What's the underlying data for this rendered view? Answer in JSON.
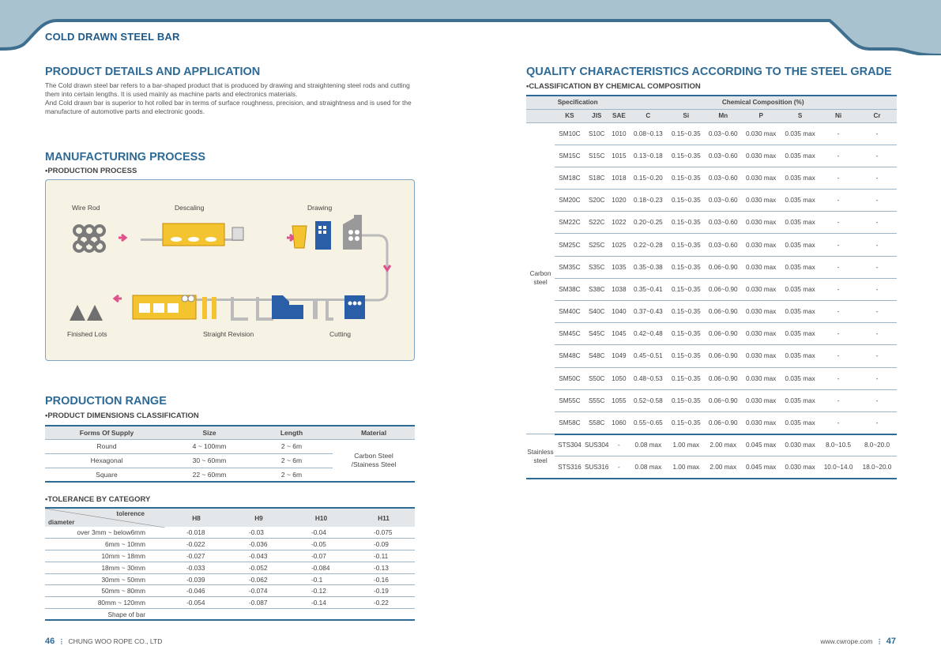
{
  "header": {
    "section_title": "COLD DRAWN STEEL BAR"
  },
  "left": {
    "details_title": "PRODUCT DETAILS AND APPLICATION",
    "details_text_1": "The Cold drawn steel bar refers to a bar-shaped product that is produced by drawing and straightening steel rods and cutting them into certain lengths. It is used mainly as machine parts and electronics materials.",
    "details_text_2": "And Cold drawn bar is superior to hot rolled bar in terms of surface roughness, precision, and straightness and is used for the manufacture of automotive parts and electronic goods.",
    "manufacturing_title": "MANUFACTURING PROCESS",
    "production_process_sub": "•PRODUCTION PROCESS",
    "process_labels": {
      "wire_rod": "Wire Rod",
      "descaling": "Descaling",
      "drawing": "Drawing",
      "finished_lots": "Finished Lots",
      "straight_revision": "Straight Revision",
      "cutting": "Cutting"
    },
    "range_title": "PRODUCTION RANGE",
    "dimensions_sub": "•PRODUCT DIMENSIONS CLASSIFICATION",
    "dimensions_table": {
      "headers": [
        "Forms Of Supply",
        "Size",
        "Length",
        "Material"
      ],
      "rows": [
        [
          "Round",
          "4 ~ 100mm",
          "2 ~ 6m"
        ],
        [
          "Hexagonal",
          "30 ~ 60mm",
          "2 ~ 6m"
        ],
        [
          "Square",
          "22 ~ 60mm",
          "2 ~ 6m"
        ]
      ],
      "material_line1": "Carbon Steel",
      "material_line2": "/Stainess Steel"
    },
    "tolerance_sub": "•TOLERANCE BY CATEGORY",
    "tolerance_table": {
      "corner_top": "tolerence",
      "corner_bottom": "diameter",
      "headers": [
        "H8",
        "H9",
        "H10",
        "H11"
      ],
      "rows": [
        [
          "over 3mm  ~ below6mm",
          "-0.018",
          "-0.03",
          "-0.04",
          "-0.075"
        ],
        [
          "6mm ~   10mm",
          "-0.022",
          "-0.036",
          "-0.05",
          "-0.09"
        ],
        [
          "10mm ~   18mm",
          "-0.027",
          "-0.043",
          "-0.07",
          "-0.11"
        ],
        [
          "18mm ~   30mm",
          "-0.033",
          "-0.052",
          "-0.084",
          "-0.13"
        ],
        [
          "30mm ~   50mm",
          "-0.039",
          "-0.062",
          "-0.1",
          "-0.16"
        ],
        [
          "50mm ~   80mm",
          "-0.046",
          "-0.074",
          "-0.12",
          "-0.19"
        ],
        [
          "80mm ~  120mm",
          "-0.054",
          "-0.087",
          "-0.14",
          "-0.22"
        ],
        [
          "Shape of bar",
          "",
          "",
          "",
          ""
        ]
      ]
    }
  },
  "right": {
    "quality_title": "QUALITY CHARACTERISTICS ACCORDING TO THE STEEL GRADE",
    "classification_sub": "•CLASSIFICATION BY CHEMICAL COMPOSITION",
    "chem_table": {
      "spec_header": "Specification",
      "comp_header": "Chemical Composition (%)",
      "sub_headers": [
        "KS",
        "JIS",
        "SAE",
        "C",
        "Si",
        "Mn",
        "P",
        "S",
        "Ni",
        "Cr"
      ],
      "carbon_label_1": "Carbon",
      "carbon_label_2": "steel",
      "stainless_label_1": "Stainless",
      "stainless_label_2": "steel",
      "carbon_rows": [
        [
          "SM10C",
          "S10C",
          "1010",
          "0.08~0.13",
          "0.15~0.35",
          "0.03~0.60",
          "0.030 max",
          "0.035 max",
          "-",
          "-"
        ],
        [
          "SM15C",
          "S15C",
          "1015",
          "0.13~0.18",
          "0.15~0.35",
          "0.03~0.60",
          "0.030 max",
          "0.035 max",
          "-",
          "-"
        ],
        [
          "SM18C",
          "S18C",
          "1018",
          "0.15~0.20",
          "0.15~0.35",
          "0.03~0.60",
          "0.030 max",
          "0.035 max",
          "-",
          "-"
        ],
        [
          "SM20C",
          "S20C",
          "1020",
          "0.18~0.23",
          "0.15~0.35",
          "0.03~0.60",
          "0.030 max",
          "0.035 max",
          "-",
          "-"
        ],
        [
          "SM22C",
          "S22C",
          "1022",
          "0.20~0.25",
          "0.15~0.35",
          "0.03~0.60",
          "0.030 max",
          "0.035 max",
          "-",
          "-"
        ],
        [
          "SM25C",
          "S25C",
          "1025",
          "0.22~0.28",
          "0.15~0.35",
          "0.03~0.60",
          "0.030 max",
          "0.035 max",
          "-",
          "-"
        ],
        [
          "SM35C",
          "S35C",
          "1035",
          "0.35~0.38",
          "0.15~0.35",
          "0.06~0.90",
          "0.030 max",
          "0.035 max",
          "-",
          "-"
        ],
        [
          "SM38C",
          "S38C",
          "1038",
          "0.35~0.41",
          "0.15~0.35",
          "0.06~0.90",
          "0.030 max",
          "0.035 max",
          "-",
          "-"
        ],
        [
          "SM40C",
          "S40C",
          "1040",
          "0.37~0.43",
          "0.15~0.35",
          "0.06~0.90",
          "0.030 max",
          "0.035 max",
          "-",
          "-"
        ],
        [
          "SM45C",
          "S45C",
          "1045",
          "0.42~0.48",
          "0.15~0.35",
          "0.06~0.90",
          "0.030 max",
          "0.035 max",
          "-",
          "-"
        ],
        [
          "SM48C",
          "S48C",
          "1049",
          "0.45~0.51",
          "0.15~0.35",
          "0.06~0.90",
          "0.030 max",
          "0.035 max",
          "-",
          "-"
        ],
        [
          "SM50C",
          "S50C",
          "1050",
          "0.48~0.53",
          "0.15~0.35",
          "0.06~0.90",
          "0.030 max",
          "0.035 max",
          "-",
          "-"
        ],
        [
          "SM55C",
          "S55C",
          "1055",
          "0.52~0.58",
          "0.15~0.35",
          "0.06~0.90",
          "0.030 max",
          "0.035 max",
          "-",
          "-"
        ],
        [
          "SM58C",
          "S58C",
          "1060",
          "0.55~0.65",
          "0.15~0.35",
          "0.06~0.90",
          "0.030 max",
          "0.035 max",
          "-",
          "-"
        ]
      ],
      "stainless_rows": [
        [
          "STS304",
          "SUS304",
          "-",
          "0.08 max",
          "1.00 max",
          "2.00 max",
          "0.045 max",
          "0.030 max",
          "8.0~10.5",
          "8.0~20.0"
        ],
        [
          "STS316",
          "SUS316",
          "-",
          "0.08 max",
          "1.00 max",
          "2.00 max",
          "0.045 max",
          "0.030 max",
          "10.0~14.0",
          "18.0~20.0"
        ]
      ]
    }
  },
  "footer": {
    "left_page": "46",
    "sep": "⋮",
    "company": "CHUNG WOO ROPE CO., LTD",
    "website": "www.cwrope.com",
    "right_page": "47"
  },
  "colors": {
    "accent": "#2e6a96",
    "banner": "#a9c2cf",
    "table_header": "#e4e7ea"
  }
}
